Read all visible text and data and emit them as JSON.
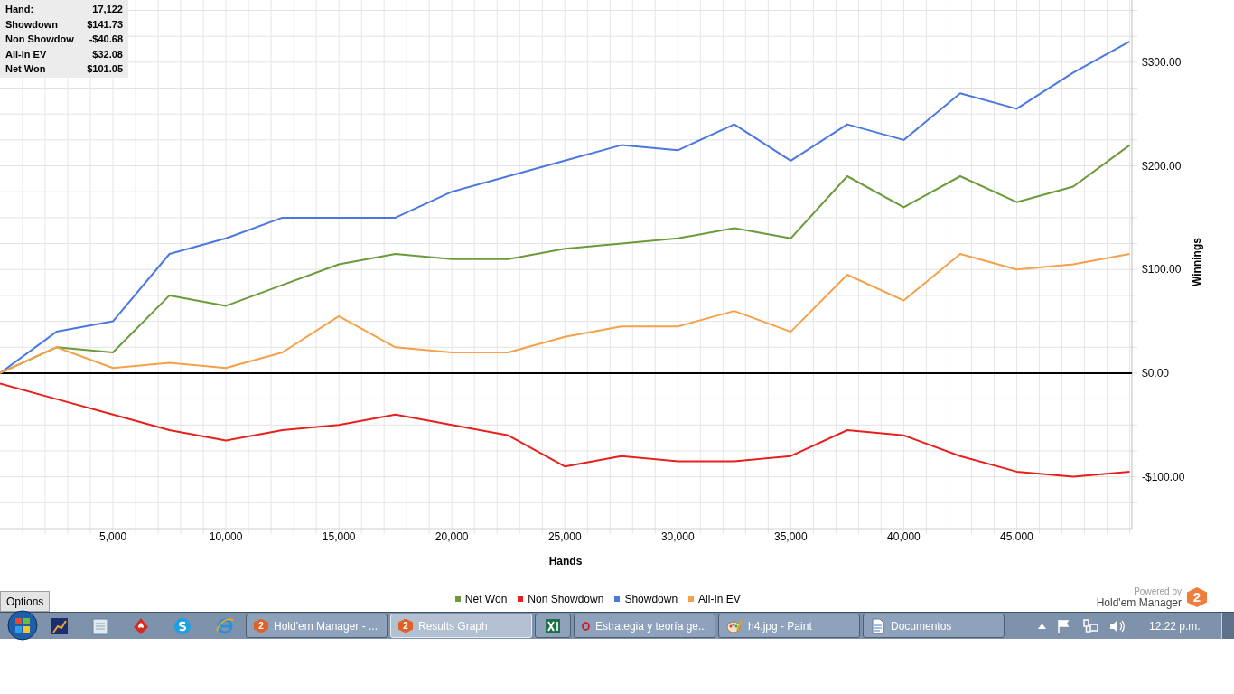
{
  "info_panel": {
    "rows": [
      {
        "label": "Hand:",
        "value": "17,122"
      },
      {
        "label": "Showdown",
        "value": "$141.73"
      },
      {
        "label": "Non Showdow",
        "value": "-$40.68"
      },
      {
        "label": "All-In EV",
        "value": "$32.08"
      },
      {
        "label": "Net Won",
        "value": "$101.05"
      }
    ]
  },
  "chart": {
    "chart_data": {
      "type": "line",
      "xlabel": "Hands",
      "ylabel": "Winnings",
      "x": [
        0,
        2500,
        5000,
        7500,
        10000,
        12500,
        15000,
        17500,
        20000,
        22500,
        25000,
        27500,
        30000,
        32500,
        35000,
        37500,
        40000,
        42500,
        45000,
        47500,
        50000
      ],
      "series": [
        {
          "name": "Net Won",
          "color": "#6a9a3a",
          "values": [
            0,
            25,
            20,
            75,
            65,
            85,
            105,
            115,
            110,
            110,
            120,
            125,
            130,
            140,
            130,
            190,
            160,
            190,
            165,
            180,
            220
          ]
        },
        {
          "name": "Non Showdown",
          "color": "#e8201c",
          "values": [
            -10,
            -25,
            -40,
            -55,
            -65,
            -55,
            -50,
            -40,
            -50,
            -60,
            -90,
            -80,
            -85,
            -85,
            -80,
            -55,
            -60,
            -80,
            -95,
            -100,
            -95
          ]
        },
        {
          "name": "Showdown",
          "color": "#4a78e0",
          "values": [
            0,
            40,
            50,
            115,
            130,
            150,
            150,
            150,
            175,
            190,
            205,
            220,
            215,
            240,
            205,
            240,
            225,
            270,
            255,
            290,
            320
          ]
        },
        {
          "name": "All-In EV",
          "color": "#f5a04a",
          "values": [
            0,
            25,
            5,
            10,
            5,
            20,
            55,
            25,
            20,
            20,
            35,
            45,
            45,
            60,
            40,
            95,
            70,
            115,
            100,
            105,
            115
          ]
        }
      ],
      "grid": true,
      "xlim": [
        0,
        50100
      ],
      "ylim": [
        -150,
        360
      ],
      "xticks": [
        {
          "value": 5000,
          "label": "5,000"
        },
        {
          "value": 10000,
          "label": "10,000"
        },
        {
          "value": 15000,
          "label": "15,000"
        },
        {
          "value": 20000,
          "label": "20,000"
        },
        {
          "value": 25000,
          "label": "25,000"
        },
        {
          "value": 30000,
          "label": "30,000"
        },
        {
          "value": 35000,
          "label": "35,000"
        },
        {
          "value": 40000,
          "label": "40,000"
        },
        {
          "value": 45000,
          "label": "45,000"
        }
      ],
      "yticks": [
        {
          "value": 300,
          "label": "$300.00"
        },
        {
          "value": 200,
          "label": "$200.00"
        },
        {
          "value": 100,
          "label": "$100.00"
        },
        {
          "value": 0,
          "label": "$0.00"
        },
        {
          "value": -100,
          "label": "-$100.00"
        }
      ]
    }
  },
  "options_button": "Options",
  "branding": {
    "caption": "Powered by",
    "product": "Hold'em Manager",
    "logo": "2"
  },
  "taskbar": {
    "tasks": [
      {
        "kind": "hm",
        "badge": "2",
        "label": "Hold'em Manager - ...",
        "selected": false
      },
      {
        "kind": "hm",
        "badge": "2",
        "label": "Results Graph",
        "selected": true
      },
      {
        "kind": "excel",
        "selected": false
      },
      {
        "kind": "opera",
        "label": "Estrategia y teoría ge...",
        "selected": false
      },
      {
        "kind": "paint",
        "label": "h4.jpg - Paint",
        "selected": false
      },
      {
        "kind": "folder",
        "label": "Documentos",
        "selected": false
      }
    ],
    "clock": "12:22 p.m."
  }
}
